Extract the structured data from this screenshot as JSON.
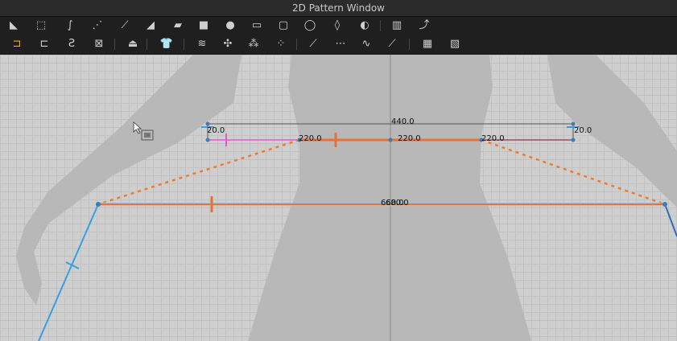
{
  "window": {
    "title": "2D Pattern Window"
  },
  "toolbar_row1": [
    {
      "name": "edit-pattern-tool-icon"
    },
    {
      "name": "transform-pattern-tool-icon"
    },
    {
      "name": "edit-curvature-tool-icon"
    },
    {
      "name": "edit-curve-point-tool-icon"
    },
    {
      "name": "add-point-tool-icon"
    },
    {
      "name": "edit-point-tool-icon"
    },
    {
      "name": "polygon-tool-icon"
    },
    {
      "name": "rectangle-tool-icon"
    },
    {
      "name": "circle-tool-icon"
    },
    {
      "name": "internal-polygon-tool-icon"
    },
    {
      "name": "internal-rectangle-tool-icon"
    },
    {
      "name": "internal-circle-tool-icon"
    },
    {
      "name": "dart-tool-icon"
    },
    {
      "name": "trace-tool-icon"
    },
    {
      "name": "pleats-tool-icon"
    },
    {
      "name": "fold-tool-icon"
    }
  ],
  "toolbar_row2": [
    {
      "name": "seam-allowance-tool-icon",
      "active": true
    },
    {
      "name": "edit-seam-allowance-tool-icon"
    },
    {
      "name": "binding-tool-icon"
    },
    {
      "name": "edit-binding-tool-icon"
    },
    {
      "name": "iron-tool-icon"
    },
    {
      "name": "garment-fit-tool-icon"
    },
    {
      "name": "shirring-tool-icon"
    },
    {
      "name": "smocking-tool-icon"
    },
    {
      "name": "quilting-tool-icon"
    },
    {
      "name": "button-tool-icon"
    },
    {
      "name": "segment-sewing-tool-icon"
    },
    {
      "name": "free-sewing-tool-icon"
    },
    {
      "name": "tack-tool-icon"
    },
    {
      "name": "edit-sewing-tool-icon"
    },
    {
      "name": "texture-tool-icon"
    },
    {
      "name": "graphic-tool-icon"
    }
  ],
  "measurements": {
    "top_total": "440.0",
    "left_small": "20.0",
    "right_small": "20.0",
    "seg_left": "220.0",
    "seg_mid": "220.0",
    "seg_right": "220.0",
    "bottom_overlap_a": "660.0",
    "bottom_overlap_b": "680.0"
  },
  "colors": {
    "accent": "#f5a623",
    "blue_line": "#3a9fe0",
    "orange_line": "#e8703a",
    "pink_line": "#e05ac8",
    "avatar": "#b8b8b8"
  }
}
